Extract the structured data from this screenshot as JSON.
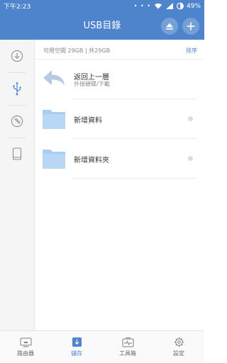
{
  "status_bar": {
    "time": "下午2:23",
    "dots": "• • •",
    "battery": "49%"
  },
  "header": {
    "title": "USB目錄",
    "eject_icon": "eject-icon",
    "add_icon": "plus-icon"
  },
  "rail": {
    "items": [
      {
        "icon": "download-circle-icon"
      },
      {
        "icon": "usb-icon",
        "active": true
      },
      {
        "icon": "no-entry-icon"
      },
      {
        "icon": "tablet-icon"
      }
    ]
  },
  "storage": {
    "info": "可用空間 29GB | 共29GB",
    "sort_label": "排序"
  },
  "files": [
    {
      "name": "返回上一層",
      "subtitle": "外接硬碟/下載",
      "icon": "back-arrow-icon"
    },
    {
      "name": "新增資料",
      "icon": "folder-icon"
    },
    {
      "name": "新增資料夾",
      "icon": "folder-icon"
    }
  ],
  "bottom_nav": [
    {
      "label": "路由器",
      "icon": "router-icon"
    },
    {
      "label": "儲存",
      "icon": "storage-icon",
      "active": true
    },
    {
      "label": "工具箱",
      "icon": "toolbox-icon"
    },
    {
      "label": "設定",
      "icon": "gear-icon"
    }
  ],
  "colors": {
    "accent": "#4d84cc",
    "folder": "#a9cdf0",
    "back_arrow": "#b6cbe3"
  }
}
